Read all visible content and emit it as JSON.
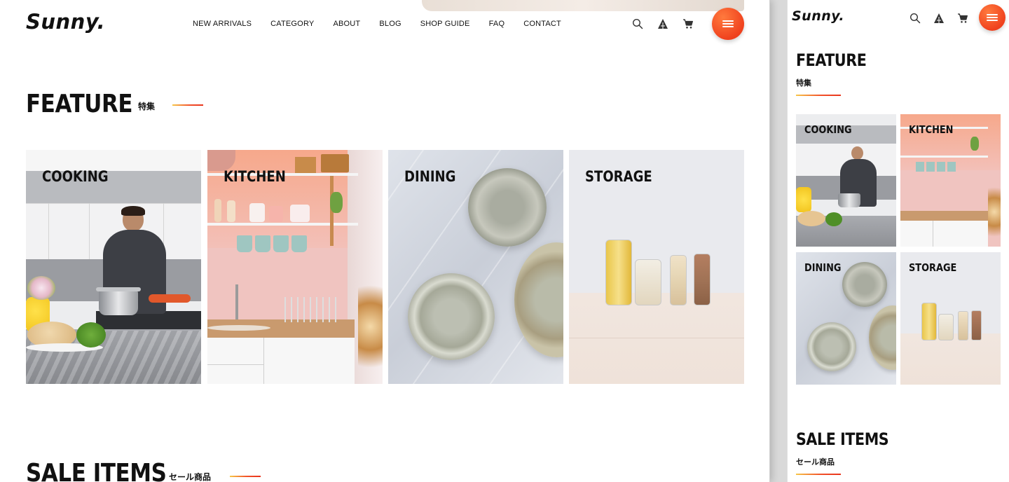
{
  "brand": {
    "logo": "Sunny."
  },
  "nav": {
    "items": [
      "NEW ARRIVALS",
      "CATEGORY",
      "ABOUT",
      "BLOG",
      "SHOP GUIDE",
      "FAQ",
      "CONTACT"
    ]
  },
  "header_icons": [
    "search-icon",
    "account-icon",
    "cart-icon",
    "hamburger-menu-icon"
  ],
  "feature": {
    "title": "FEATURE",
    "subtitle": "特集",
    "cards": [
      {
        "label": "COOKING"
      },
      {
        "label": "KITCHEN"
      },
      {
        "label": "DINING"
      },
      {
        "label": "STORAGE"
      }
    ]
  },
  "sale": {
    "title": "SALE ITEMS",
    "subtitle": "セール商品"
  },
  "colors": {
    "accent_start": "#f7c84a",
    "accent_mid": "#f2522a",
    "accent_end": "#e8341c",
    "menu_button": "#f0421e"
  }
}
